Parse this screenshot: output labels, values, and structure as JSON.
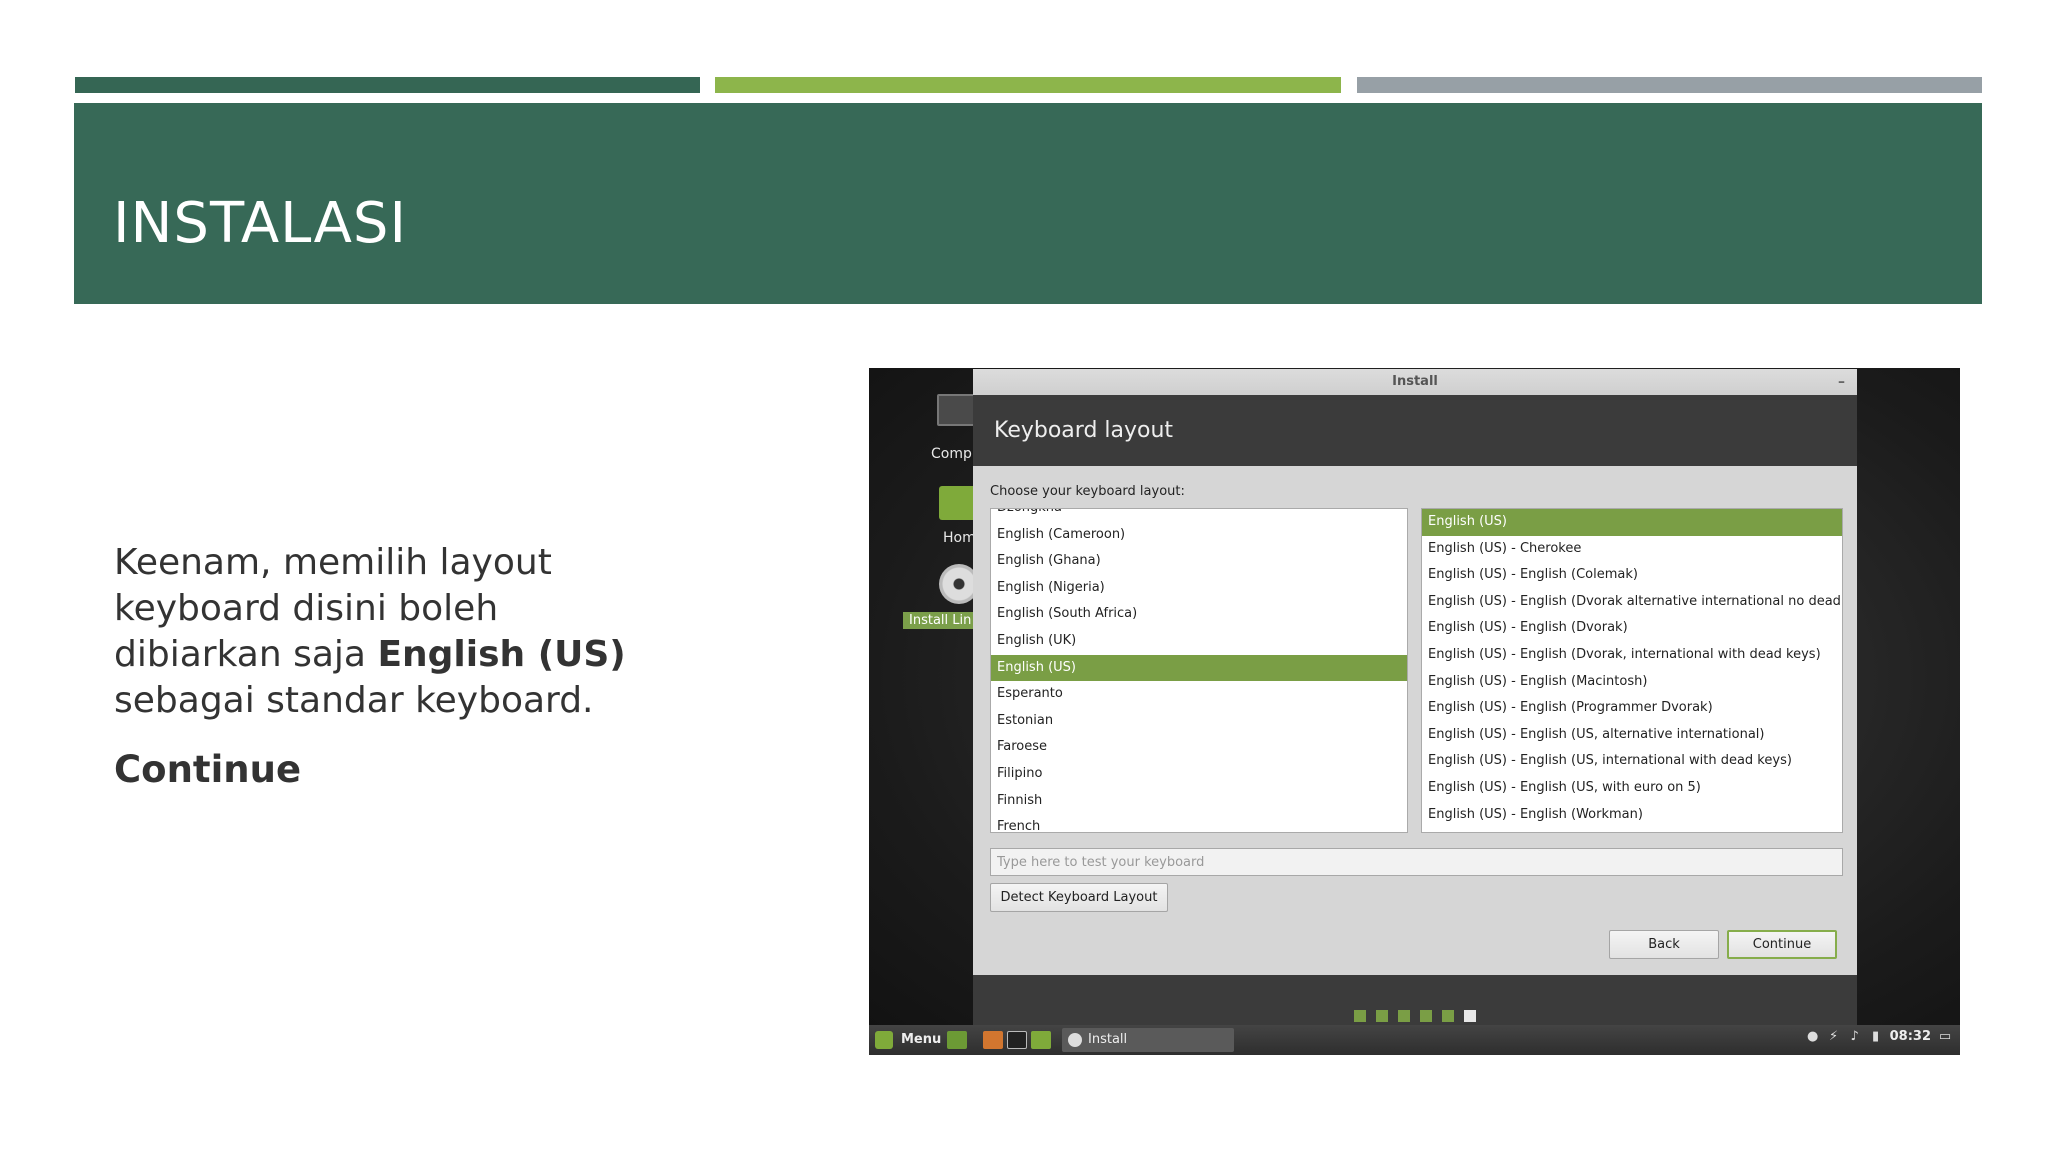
{
  "slide": {
    "title": "INSTALASI",
    "body_pre": "Keenam, memilih layout keyboard disini boleh dibiarkan saja ",
    "body_bold": "English (US)",
    "body_post": " sebagai standar keyboard.",
    "continue_text": "Continue"
  },
  "colors": {
    "strip1": "#356654",
    "strip2": "#8db54b",
    "strip3": "#97a0a6",
    "banner": "#376957",
    "selection": "#7a9e45"
  },
  "desktop": {
    "icons": [
      {
        "label": "Compu",
        "icon": "computer-icon"
      },
      {
        "label": "Hom",
        "icon": "home-folder-icon"
      },
      {
        "label": "Install Lin",
        "icon": "disc-icon"
      }
    ]
  },
  "window": {
    "title": "Install",
    "minimize_glyph": "–",
    "header": "Keyboard layout",
    "prompt": "Choose your keyboard layout:",
    "layouts": [
      "Dzongkha",
      "English (Cameroon)",
      "English (Ghana)",
      "English (Nigeria)",
      "English (South Africa)",
      "English (UK)",
      "English (US)",
      "Esperanto",
      "Estonian",
      "Faroese",
      "Filipino",
      "Finnish",
      "French"
    ],
    "selected_layout": "English (US)",
    "variants": [
      "English (US)",
      "English (US) - Cherokee",
      "English (US) - English (Colemak)",
      "English (US) - English (Dvorak alternative international no dead keys)",
      "English (US) - English (Dvorak)",
      "English (US) - English (Dvorak, international with dead keys)",
      "English (US) - English (Macintosh)",
      "English (US) - English (Programmer Dvorak)",
      "English (US) - English (US, alternative international)",
      "English (US) - English (US, international with dead keys)",
      "English (US) - English (US, with euro on 5)",
      "English (US) - English (Workman)"
    ],
    "selected_variant": "English (US)",
    "test_placeholder": "Type here to test your keyboard",
    "detect_label": "Detect Keyboard Layout",
    "back_label": "Back",
    "continue_label": "Continue",
    "progress_steps": 6,
    "current_step": 6
  },
  "taskbar": {
    "menu_label": "Menu",
    "window_label": "Install",
    "clock": "08:32"
  }
}
